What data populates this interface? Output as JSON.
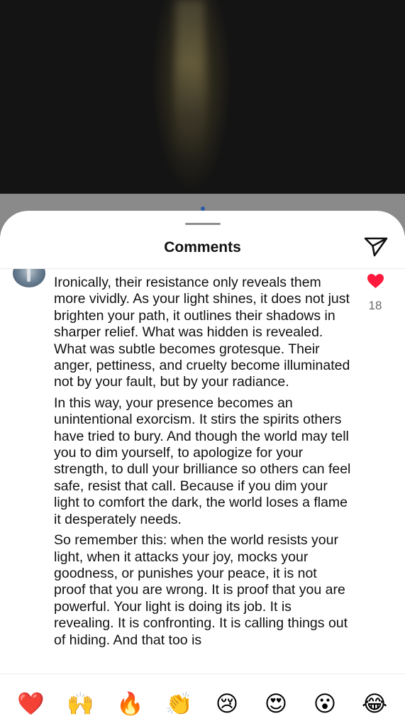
{
  "sheet": {
    "title": "Comments",
    "send_icon": "paper-plane-icon"
  },
  "comment": {
    "paragraphs": [
      "Ironically, their resistance only reveals them more vividly. As your light shines, it does not just brighten your path, it outlines their shadows in sharper relief. What was hidden is revealed. What was subtle becomes grotesque. Their anger, pettiness, and cruelty become illuminated not by your fault, but by your radiance.",
      "In this way, your presence becomes an unintentional exorcism. It stirs the spirits others have tried to bury. And though the world may tell you to dim yourself, to apologize for your strength, to dull your brilliance so others can feel safe, resist that call. Because if you dim your light to comfort the dark, the world loses a flame it desperately needs.",
      "So remember this: when the world resists your light, when it attacks your joy, mocks your goodness, or punishes your peace, it is not proof that you are wrong. It is proof that you are powerful. Your light is doing its job. It is revealing. It is confronting. It is calling things out of hiding. And that too is"
    ],
    "like_icon": "heart-filled-icon",
    "like_count": "18",
    "like_color": "#ff1a3d"
  },
  "emoji_bar": {
    "emojis": [
      {
        "name": "heart-emoji",
        "glyph": "❤️"
      },
      {
        "name": "raised-hands-emoji",
        "glyph": "🙌"
      },
      {
        "name": "fire-emoji",
        "glyph": "🔥"
      },
      {
        "name": "clapping-hands-emoji",
        "glyph": "👏"
      },
      {
        "name": "crying-face-emoji",
        "glyph": "😢"
      },
      {
        "name": "heart-eyes-emoji",
        "glyph": "😍"
      },
      {
        "name": "surprised-face-emoji",
        "glyph": "😮"
      },
      {
        "name": "tears-of-joy-emoji",
        "glyph": "😂"
      }
    ]
  }
}
